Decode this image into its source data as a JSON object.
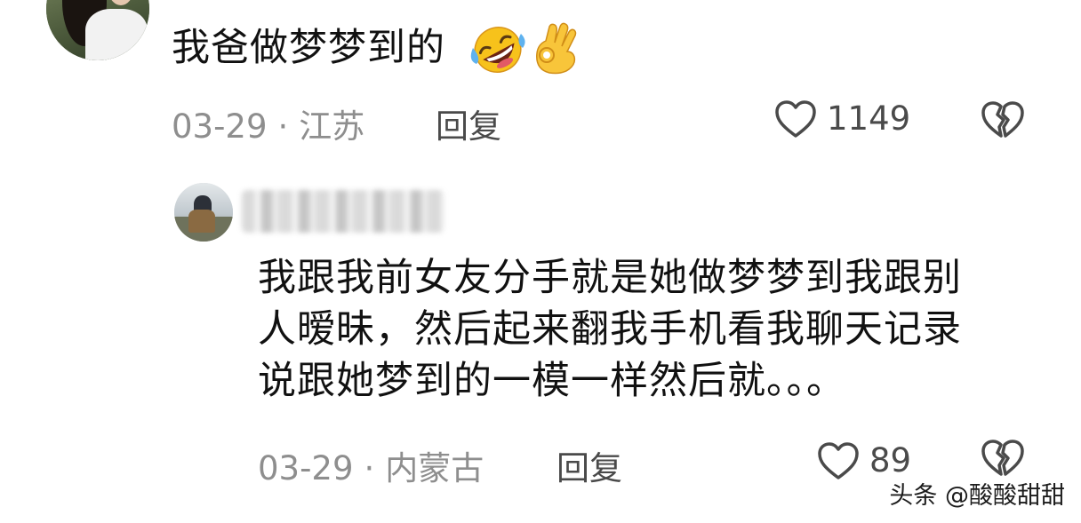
{
  "top_comment": {
    "text": "我爸做梦梦到的",
    "emojis": [
      "rolling-laughing-emoji",
      "ok-hand-emoji"
    ],
    "date": "03-29",
    "separator": "·",
    "location": "江苏",
    "reply_label": "回复",
    "like_count": "1149"
  },
  "reply_comment": {
    "lines": [
      "我跟我前女友分手就是她做梦梦到我跟别",
      "人暧昧，然后起来翻我手机看我聊天记录",
      "说跟她梦到的一模一样然后就。。。"
    ],
    "date": "03-29",
    "separator": "·",
    "location": "内蒙古",
    "reply_label": "回复",
    "like_count": "89"
  },
  "watermark": "头条 @酸酸甜甜",
  "icons": {
    "like": "heart-outline-icon",
    "dislike": "broken-heart-icon"
  },
  "colors": {
    "text_primary": "#111111",
    "text_meta": "#8e8e8e",
    "text_action": "#4a4a4a",
    "icon": "#4a4a4a"
  }
}
